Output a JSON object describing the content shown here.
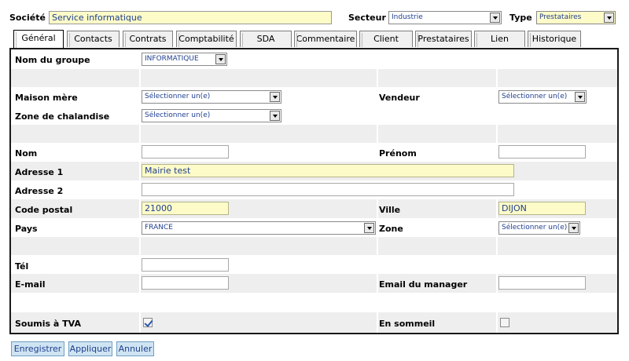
{
  "header": {
    "societe_label": "Société",
    "societe_value": "Service informatique",
    "secteur_label": "Secteur",
    "secteur_value": "Industrie",
    "type_label": "Type",
    "type_value": "Prestataires"
  },
  "tabs": [
    {
      "label": "Général",
      "active": true
    },
    {
      "label": "Contacts"
    },
    {
      "label": "Contrats"
    },
    {
      "label": "Comptabilité"
    },
    {
      "label": "SDA"
    },
    {
      "label": "Commentaire"
    },
    {
      "label": "Client"
    },
    {
      "label": "Prestataires"
    },
    {
      "label": "Lien"
    },
    {
      "label": "Historique"
    }
  ],
  "form": {
    "groupe_label": "Nom du groupe",
    "groupe_value": "INFORMATIQUE",
    "maison_mere_label": "Maison mère",
    "maison_mere_value": "Sélectionner un(e)",
    "vendeur_label": "Vendeur",
    "vendeur_value": "Sélectionner un(e)",
    "zone_chalandise_label": "Zone de chalandise",
    "zone_chalandise_value": "Sélectionner un(e)",
    "nom_label": "Nom",
    "nom_value": "",
    "prenom_label": "Prénom",
    "prenom_value": "",
    "adresse1_label": "Adresse 1",
    "adresse1_value": "Mairie test",
    "adresse2_label": "Adresse 2",
    "adresse2_value": "",
    "code_postal_label": "Code postal",
    "code_postal_value": "21000",
    "ville_label": "Ville",
    "ville_value": "DIJON",
    "pays_label": "Pays",
    "pays_value": "FRANCE",
    "zone_label": "Zone",
    "zone_value": "Sélectionner un(e)",
    "tel_label": "Tél",
    "tel_value": "",
    "email_label": "E-mail",
    "email_value": "",
    "email_manager_label": "Email du manager",
    "email_manager_value": "",
    "tva_label": "Soumis à TVA",
    "tva_checked": true,
    "sommeil_label": "En sommeil",
    "sommeil_checked": false
  },
  "buttons": {
    "save": "Enregistrer",
    "apply": "Appliquer",
    "cancel": "Annuler"
  },
  "colors": {
    "highlight_field": "#fdfbc8",
    "button_bg": "#cfe4f2",
    "text_blue": "#1f3f8f"
  }
}
